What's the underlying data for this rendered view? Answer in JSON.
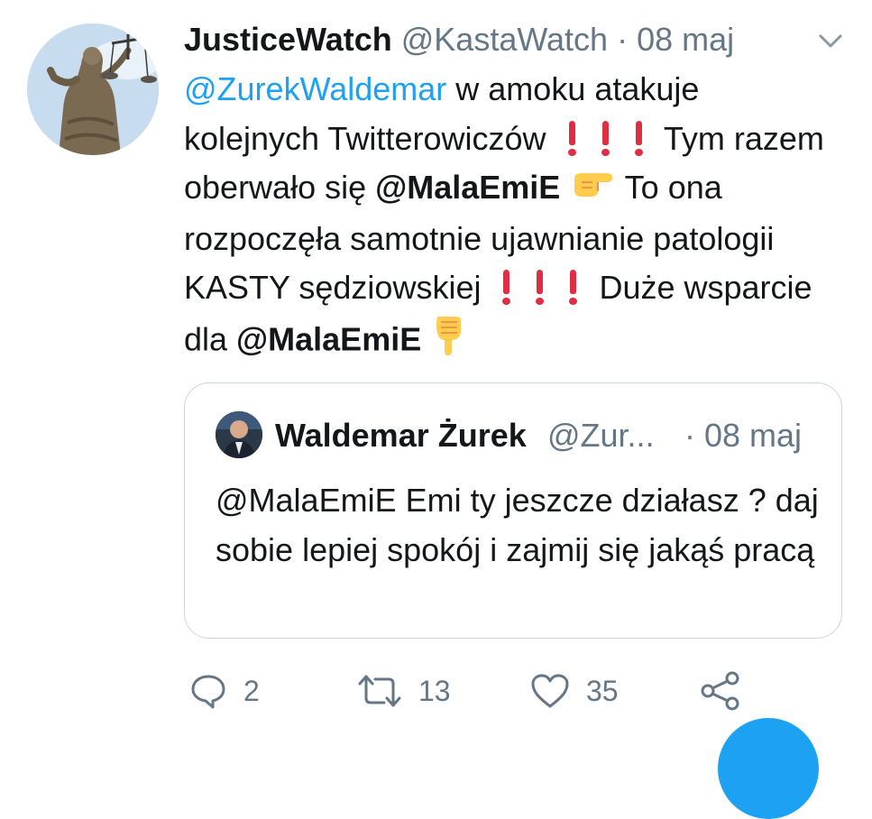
{
  "tweet": {
    "author_name": "JusticeWatch",
    "author_handle": "@KastaWatch",
    "separator": "·",
    "date": "08 maj",
    "avatar_icon": "lady-justice-statue-icon",
    "menu_icon": "chevron-down-icon",
    "lines": {
      "mention_zurek": "@ZurekWaldemar",
      "t1": " w amoku atakuje kolejnych Twitterowiczów ",
      "t2": " Tym razem oberwało się ",
      "mention_emi_1": "@MalaEmiE",
      "emoji_pointing_right": "👉",
      "t3": " To ona rozpoczęła samotnie ujawnianie patologii KASTY sędziowskiej ",
      "t4": " Duże wsparcie dla ",
      "mention_emi_2": "@MalaEmiE",
      "emoji_pointing_down": "👇"
    }
  },
  "quoted_tweet": {
    "author_name": "Waldemar Żurek",
    "author_handle": "@Zur...",
    "date": "· 08 maj",
    "text": "@MalaEmiE Emi ty jeszcze działasz ? daj sobie lepiej spokój i zajmij się jakąś  pracą"
  },
  "actions": {
    "reply_count": "2",
    "retweet_count": "13",
    "like_count": "35"
  },
  "colors": {
    "link": "#1da1f2",
    "muted": "#657786",
    "text": "#14171a",
    "exclamation": "#dd2e44",
    "border": "#ccd6dd"
  }
}
